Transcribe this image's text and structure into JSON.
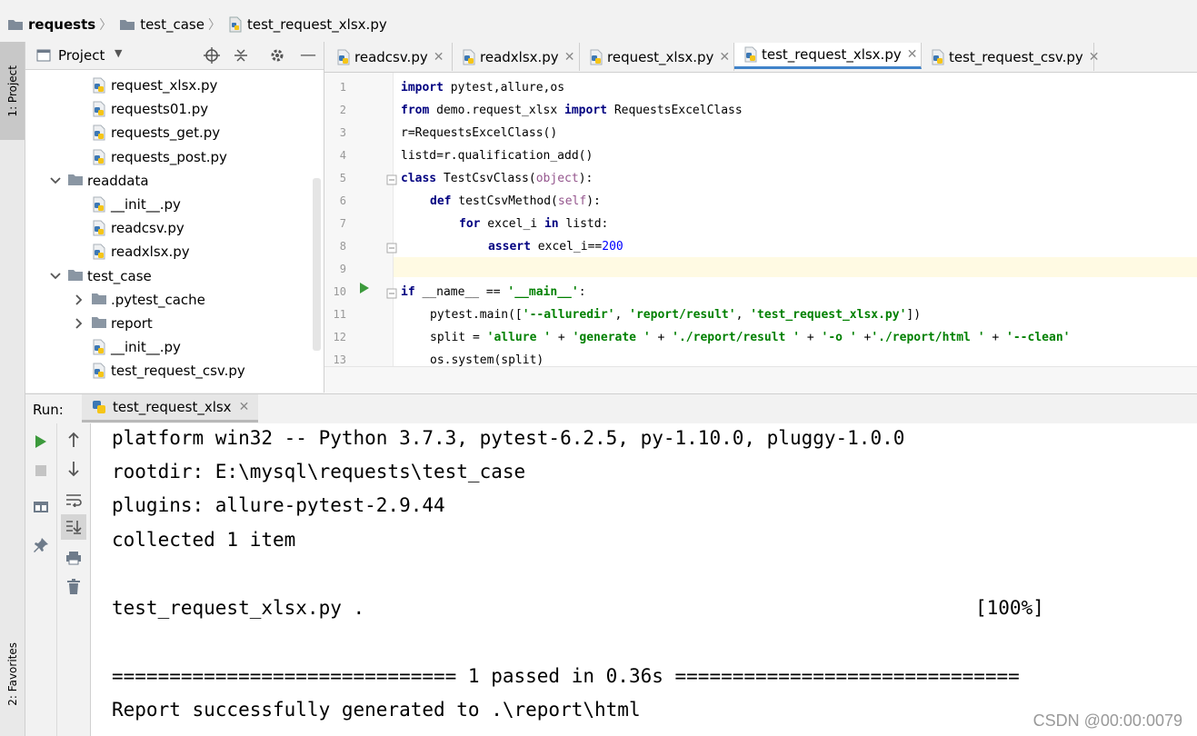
{
  "breadcrumb": [
    "requests",
    "test_case",
    "test_request_xlsx.py"
  ],
  "left_strip": {
    "project_tab": "1: Project",
    "favorites_tab": "2: Favorites"
  },
  "project_panel": {
    "title": "Project"
  },
  "tree": [
    {
      "label": "request_xlsx.py",
      "type": "py",
      "level": 2
    },
    {
      "label": "requests01.py",
      "type": "py",
      "level": 2
    },
    {
      "label": "requests_get.py",
      "type": "py",
      "level": 2
    },
    {
      "label": "requests_post.py",
      "type": "py",
      "level": 2
    },
    {
      "label": "readdata",
      "type": "folder-open",
      "level": 1
    },
    {
      "label": "__init__.py",
      "type": "py",
      "level": 2
    },
    {
      "label": "readcsv.py",
      "type": "py",
      "level": 2
    },
    {
      "label": "readxlsx.py",
      "type": "py",
      "level": 2
    },
    {
      "label": "test_case",
      "type": "folder-open",
      "level": 1
    },
    {
      "label": ".pytest_cache",
      "type": "folder-closed",
      "level": 2
    },
    {
      "label": "report",
      "type": "folder-closed",
      "level": 2
    },
    {
      "label": "__init__.py",
      "type": "py",
      "level": 2
    },
    {
      "label": "test_request_csv.py",
      "type": "py",
      "level": 2
    }
  ],
  "tabs": [
    {
      "label": "readcsv.py",
      "active": false
    },
    {
      "label": "readxlsx.py",
      "active": false
    },
    {
      "label": "request_xlsx.py",
      "active": false
    },
    {
      "label": "test_request_xlsx.py",
      "active": true
    },
    {
      "label": "test_request_csv.py",
      "active": false
    }
  ],
  "code_lines": [
    "1",
    "2",
    "3",
    "4",
    "5",
    "6",
    "7",
    "8",
    "9",
    "10",
    "11",
    "12",
    "13"
  ],
  "code": {
    "l1a": "import",
    "l1b": " pytest,allure,os",
    "l2a": "from",
    "l2b": " demo.request_xlsx ",
    "l2c": "import",
    "l2d": " RequestsExcelClass",
    "l3": "r=RequestsExcelClass()",
    "l4": "listd=r.qualification_add()",
    "l5a": "class",
    "l5b": " TestCsvClass(",
    "l5c": "object",
    "l5d": "):",
    "l6a": "def",
    "l6b": " testCsvMethod(",
    "l6c": "self",
    "l6d": "):",
    "l7a": "for",
    "l7b": " excel_i ",
    "l7c": "in",
    "l7d": " listd:",
    "l8a": "assert",
    "l8b": " excel_i==",
    "l8c": "200",
    "l10a": "if",
    "l10b": " __name__ == ",
    "l10c": "'__main__'",
    "l10d": ":",
    "l11a": "pytest.main([",
    "l11b": "'--alluredir'",
    "l11c": ", ",
    "l11d": "'report/result'",
    "l11e": ", ",
    "l11f": "'test_request_xlsx.py'",
    "l11g": "])",
    "l12a": "split = ",
    "l12b": "'allure '",
    "l12c": " + ",
    "l12d": "'generate '",
    "l12e": " + ",
    "l12f": "'./report/result '",
    "l12g": " + ",
    "l12h": "'-o '",
    "l12i": " +",
    "l12j": "'./report/html '",
    "l12k": " + ",
    "l12l": "'--clean'",
    "l13": "os.system(split)"
  },
  "run": {
    "label": "Run:",
    "tab": "test_request_xlsx"
  },
  "console": {
    "l1": "platform win32 -- Python 3.7.3, pytest-6.2.5, py-1.10.0, pluggy-1.0.0",
    "l2": "rootdir: E:\\mysql\\requests\\test_case",
    "l3": "plugins: allure-pytest-2.9.44",
    "l4": "collected 1 item",
    "l5": "test_request_xlsx.py .",
    "l5pct": "[100%]",
    "l6": "============================== 1 passed in 0.36s ==============================",
    "l7": "Report successfully generated to .\\report\\html"
  },
  "watermark": "CSDN @00:00:0079",
  "colors": {
    "keyword": "#000080",
    "string": "#008000",
    "number": "#0000ff",
    "self": "#94558d",
    "tab_active_underline": "#4083c9",
    "run_green": "#3c9a3c"
  }
}
